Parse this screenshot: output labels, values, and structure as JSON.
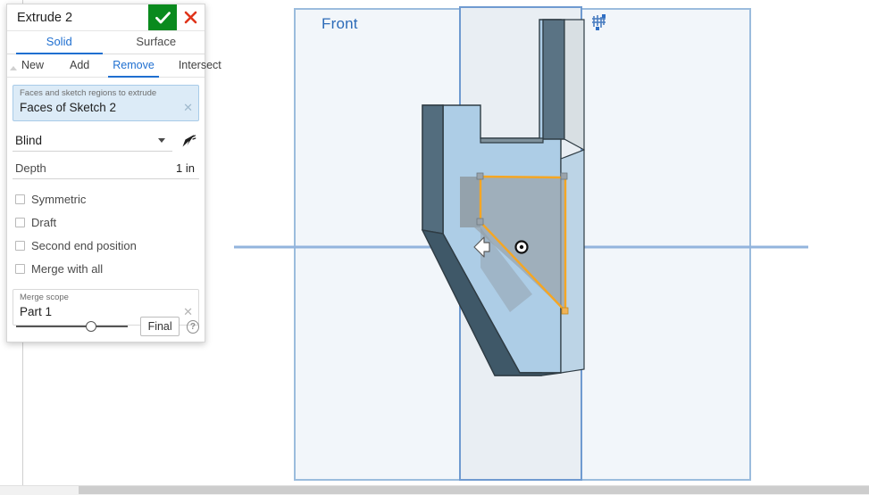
{
  "dialog": {
    "title": "Extrude 2",
    "accept_icon": "check-icon",
    "cancel_icon": "close-icon",
    "primary_tabs": [
      {
        "label": "Solid",
        "active": true
      },
      {
        "label": "Surface",
        "active": false
      }
    ],
    "secondary_tabs": [
      {
        "label": "New",
        "active": false
      },
      {
        "label": "Add",
        "active": false
      },
      {
        "label": "Remove",
        "active": true
      },
      {
        "label": "Intersect",
        "active": false
      }
    ],
    "query": {
      "label": "Faces and sketch regions to extrude",
      "value": "Faces of Sketch 2",
      "clear_icon": "close-small-icon"
    },
    "end_condition": {
      "value": "Blind",
      "dropdown_icon": "chevron-down-icon",
      "flip_icon": "flip-direction-icon"
    },
    "depth": {
      "label": "Depth",
      "value": "1 in"
    },
    "checkboxes": [
      {
        "label": "Symmetric",
        "checked": false
      },
      {
        "label": "Draft",
        "checked": false
      },
      {
        "label": "Second end position",
        "checked": false
      },
      {
        "label": "Merge with all",
        "checked": false
      }
    ],
    "merge_scope": {
      "label": "Merge scope",
      "value": "Part 1",
      "clear_icon": "close-small-icon"
    },
    "footer": {
      "preview_quality_slider_value": 62,
      "final_label": "Final",
      "help_icon": "help-icon",
      "help_glyph": "?"
    }
  },
  "viewport": {
    "plane_label": "Front",
    "plane_label_color": "#2c6bb8",
    "plane_corner_icon": "sketch-plane-handle-icon",
    "direction_arrow_icon": "extrude-direction-arrow-icon",
    "origin_icon": "origin-point-icon",
    "colors": {
      "part_front_face": "#adcde6",
      "part_side_face": "#536d7e",
      "part_edge": "#2f3c44",
      "selected_sketch": "#f5a623",
      "plane_fill": "#f2f6fa",
      "plane_border": "#9bbcdd",
      "construction_line": "#93b4dd",
      "sketch_region_fill": "#9aa3ab"
    }
  }
}
